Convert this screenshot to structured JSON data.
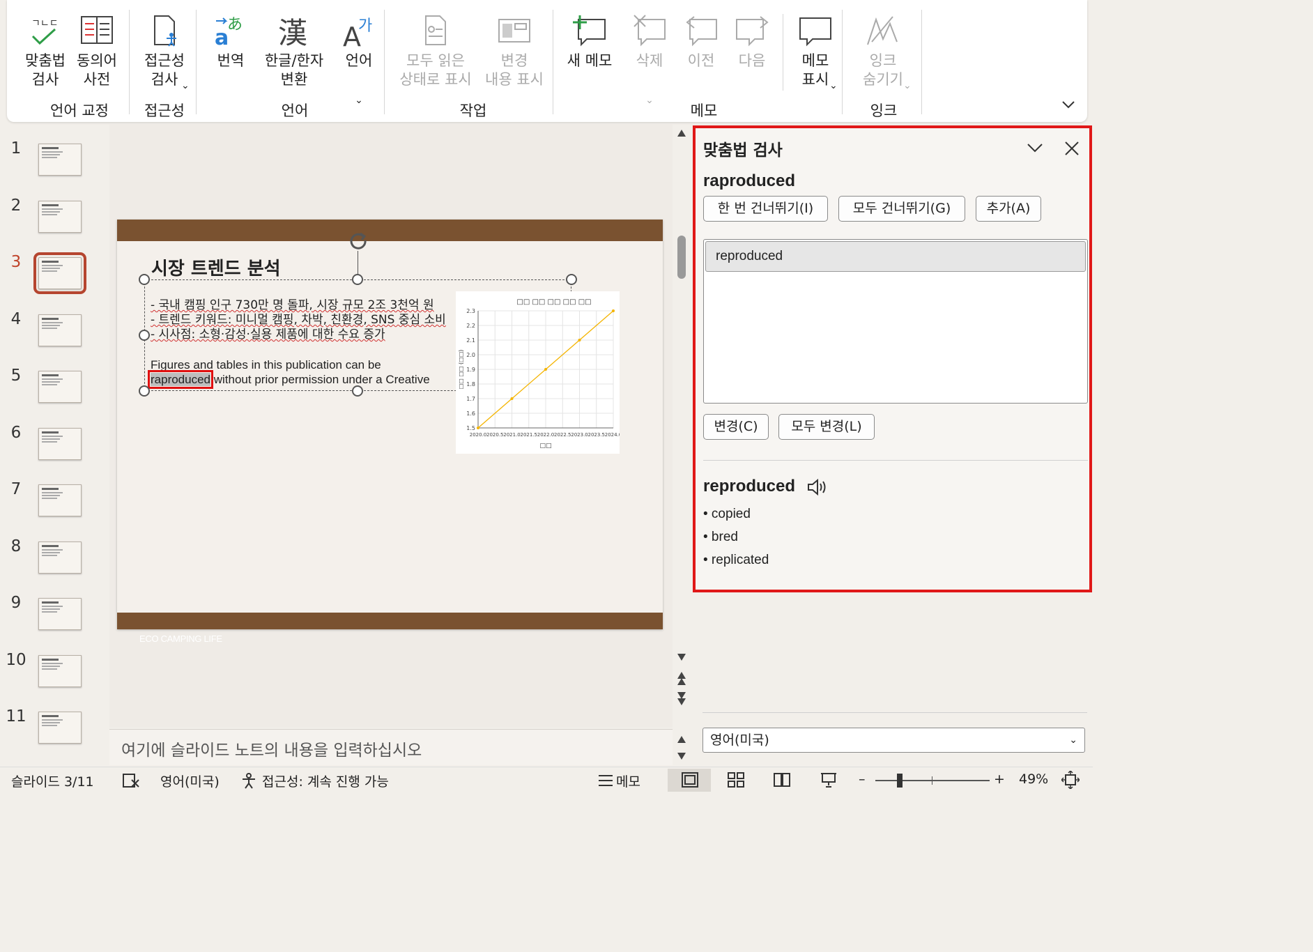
{
  "ribbon": {
    "groups": [
      {
        "label": "언어 교정",
        "buttons": [
          {
            "label": "맞춤법\n검사",
            "icon": "spellcheck-icon"
          },
          {
            "label": "동의어\n사전",
            "icon": "thesaurus-icon"
          }
        ]
      },
      {
        "label": "접근성",
        "buttons": [
          {
            "label": "접근성\n검사",
            "icon": "accessibility-check-icon"
          }
        ]
      },
      {
        "label": "언어",
        "buttons": [
          {
            "label": "번역",
            "icon": "translate-icon"
          },
          {
            "label": "한글/한자\n변환",
            "icon": "hanja-icon"
          },
          {
            "label": "언어",
            "icon": "language-icon"
          }
        ]
      },
      {
        "label": "작업",
        "buttons": [
          {
            "label": "모두 읽은\n상태로 표시",
            "icon": "mark-read-icon"
          },
          {
            "label": "변경\n내용 표시",
            "icon": "show-changes-icon"
          }
        ]
      },
      {
        "label": "메모",
        "buttons": [
          {
            "label": "새 메모",
            "icon": "new-comment-icon"
          },
          {
            "label": "삭제",
            "icon": "delete-comment-icon"
          },
          {
            "label": "이전",
            "icon": "previous-comment-icon"
          },
          {
            "label": "다음",
            "icon": "next-comment-icon"
          },
          {
            "label": "메모\n표시",
            "icon": "show-comments-icon"
          }
        ]
      },
      {
        "label": "잉크",
        "buttons": [
          {
            "label": "잉크\n숨기기",
            "icon": "hide-ink-icon"
          }
        ]
      }
    ]
  },
  "thumbnails": [
    "1",
    "2",
    "3",
    "4",
    "5",
    "6",
    "7",
    "8",
    "9",
    "10",
    "11"
  ],
  "slide": {
    "title": "시장 트렌드 분석",
    "bullets": [
      "- 국내 캠핑 인구 730만 명 돌파, 시장 규모 2조 3천억 원",
      "- 트렌드 키워드: 미니멀 캠핑, 차박, 친환경, SNS 중심 소비",
      "- 시사점: 소형·감성·실용 제품에 대한 수요 증가"
    ],
    "body_line1": "Figures and tables in this publication can be",
    "misspelled": "raproduced",
    "body_line2_rest": " without prior permission under a Creative",
    "footer": "ECO CAMPING LIFE"
  },
  "chart_data": {
    "type": "line",
    "title": "□□ □□ □□ □□ □□",
    "xlabel": "□□",
    "ylabel": "□□ □□ (□□)",
    "x": [
      2020.0,
      2021.0,
      2022.0,
      2023.0,
      2024.0
    ],
    "x_tick_labels": [
      "2020.0",
      "2020.5",
      "2021.0",
      "2021.5",
      "2022.0",
      "2022.5",
      "2023.0",
      "2023.5",
      "2024.0"
    ],
    "y_ticks": [
      "2.3",
      "2.2",
      "2.1",
      "2.0",
      "1.9",
      "1.8",
      "1.7",
      "1.6",
      "1.5"
    ],
    "ylim": [
      1.5,
      2.3
    ],
    "series": [
      {
        "values": [
          1.5,
          1.7,
          1.9,
          2.1,
          2.3
        ],
        "color": "#f4b400"
      }
    ],
    "grid": true
  },
  "notes": {
    "placeholder": "여기에 슬라이드 노트의 내용을 입력하십시오"
  },
  "spelling_pane": {
    "title": "맞춤법 검사",
    "word": "raproduced",
    "ignore_once": "한 번 건너뛰기(I)",
    "ignore_all": "모두 건너뛰기(G)",
    "add": "추가(A)",
    "suggestions": [
      "reproduced"
    ],
    "change": "변경(C)",
    "change_all": "모두 변경(L)",
    "definition_word": "reproduced",
    "synonyms": [
      "• copied",
      "• bred",
      "• replicated"
    ],
    "language": "영어(미국)"
  },
  "status_bar": {
    "slide": "슬라이드 3/11",
    "language": "영어(미국)",
    "accessibility": "접근성: 계속 진행 가능",
    "notes": "메모",
    "zoom": "49%"
  }
}
